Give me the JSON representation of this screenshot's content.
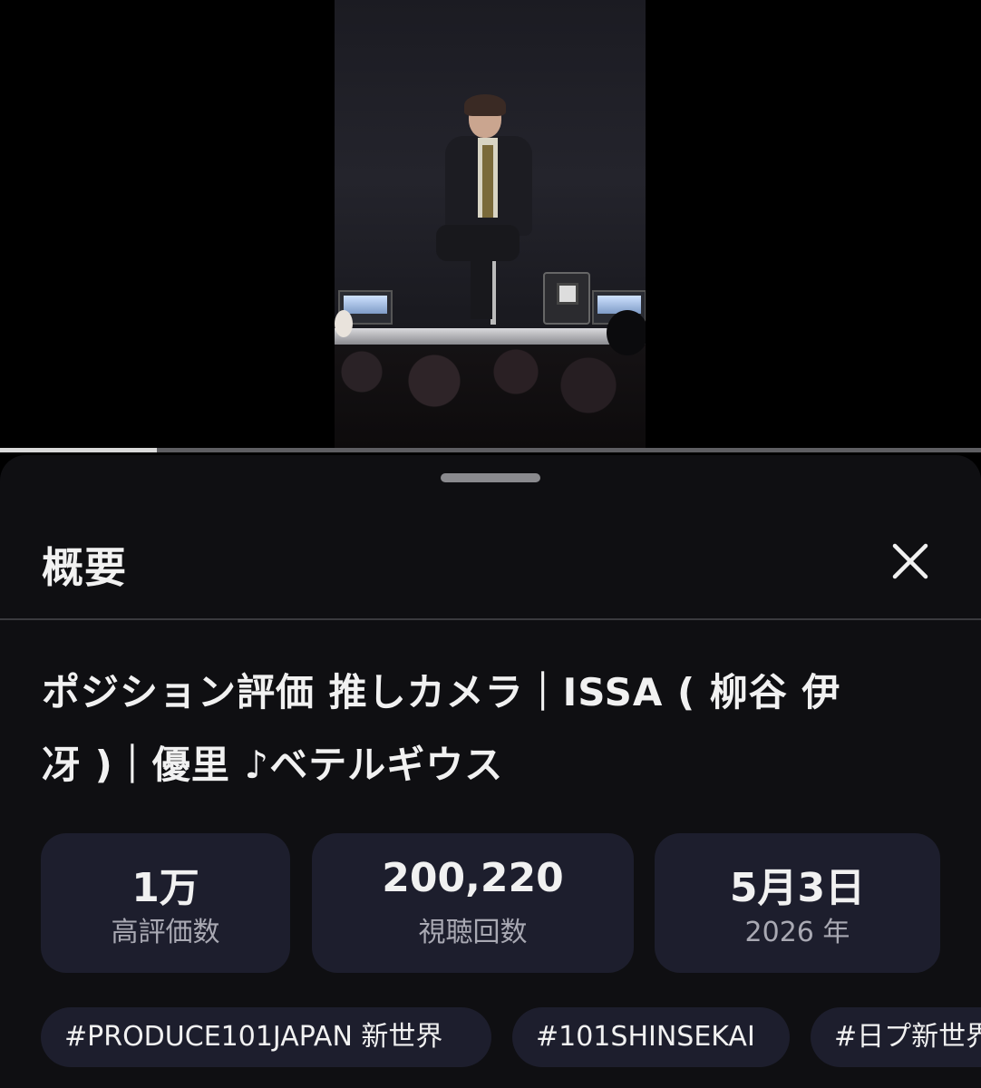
{
  "video": {
    "progress_fraction": 0.16
  },
  "description_panel": {
    "title": "概要",
    "close_icon": "close-icon",
    "video_title_line1": "ポジション評価 推しカメラ｜ISSA ( 柳谷 伊",
    "video_title_line2": "冴 )｜優里 ♪ベテルギウス",
    "stats": [
      {
        "value": "1万",
        "label": "高評価数"
      },
      {
        "value": "200,220",
        "label": "視聴回数"
      },
      {
        "value": "5月3日",
        "label": "2026 年"
      }
    ],
    "hashtags": [
      "#PRODUCE101JAPAN 新世界",
      "#101SHINSEKAI",
      "#日プ新世界"
    ]
  },
  "colors": {
    "sheet_bg": "#0f0f12",
    "card_bg": "#1d1e2d",
    "text_primary": "#f1f1f1",
    "text_secondary": "#a9a9b3"
  }
}
